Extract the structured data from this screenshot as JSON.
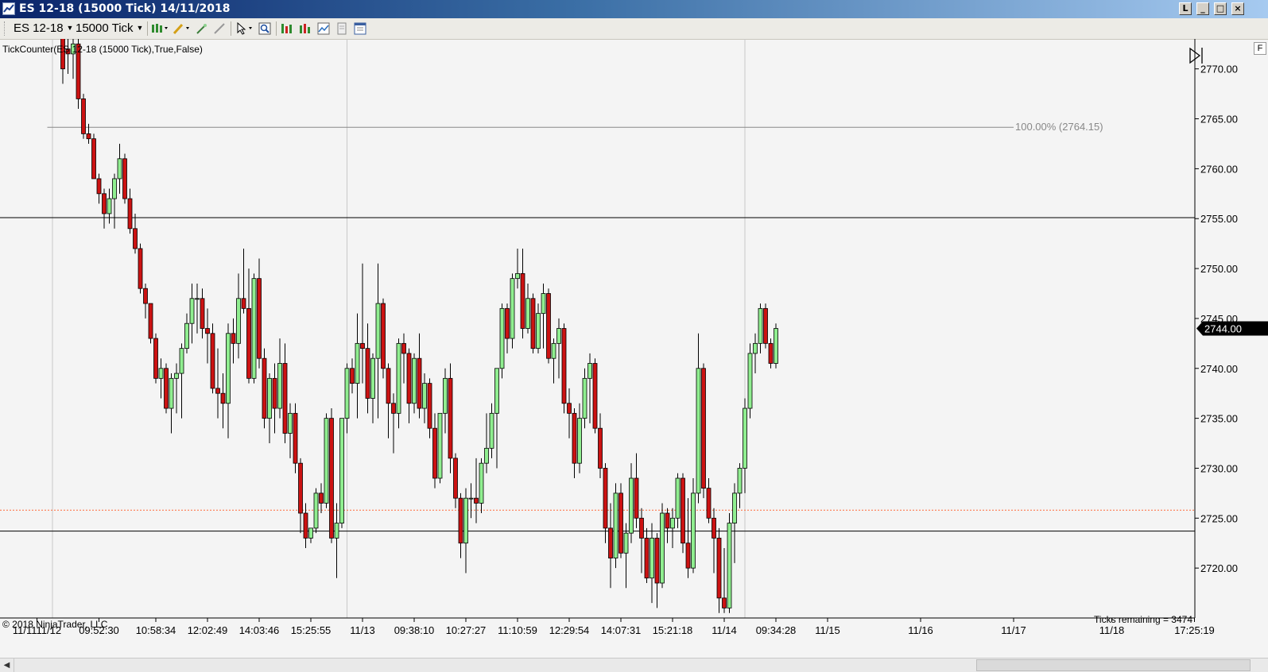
{
  "window": {
    "title": "ES 12-18 (15000 Tick)  14/11/2018",
    "buttons": [
      "L",
      "_",
      "□",
      "×"
    ]
  },
  "toolbar": {
    "instrument": "ES 12-18",
    "interval": "15000 Tick",
    "icons": [
      "candlestick-style-icon",
      "pencil-draw-icon",
      "magic-wand-icon",
      "pointer-tool-icon",
      "crosshair-cursor-icon",
      "zoom-icon",
      "bar-spacing-icon",
      "data-box-icon",
      "indicators-icon",
      "strategies-icon",
      "properties-icon"
    ]
  },
  "indicator_label": "TickCounter(ES  12-18 (15000  Tick),True,False)",
  "copyright": "© 2018 NinjaTrader, LLC",
  "ticks_remaining": "Ticks remaining = 3474",
  "right_edge_label": "F",
  "colors": {
    "background": "#f4f4f4",
    "up_candle": "#90ee90",
    "down_candle": "#cc1212",
    "candle_outline": "#000000",
    "horizontal_lines": "#000000",
    "dotted_line": "#ff6a3a",
    "fib_line": "#888888",
    "axis_text": "#000000"
  },
  "chart_data": {
    "type": "candlestick",
    "instrument": "ES 12-18",
    "bar_type": "15000 Tick",
    "ylim": [
      2715,
      2773
    ],
    "y_ticks": [
      2720,
      2725,
      2730,
      2735,
      2740,
      2745,
      2750,
      2755,
      2760,
      2765,
      2770
    ],
    "y_tick_labels": [
      "2720.00",
      "2725.00",
      "2730.00",
      "2735.00",
      "2740.00",
      "2745.00",
      "2750.00",
      "2755.00",
      "2760.00",
      "2765.00",
      "2770.00"
    ],
    "x_tick_labels": [
      "11/1111/12",
      "09:52:30",
      "10:58:34",
      "12:02:49",
      "14:03:46",
      "15:25:55",
      "11/13",
      "09:38:10",
      "10:27:27",
      "11:10:59",
      "12:29:54",
      "14:07:31",
      "15:21:18",
      "11/14",
      "09:34:28",
      "11/15",
      "11/16",
      "11/17",
      "11/18",
      "17:25:19"
    ],
    "x_tick_bar_index": [
      -5,
      7,
      18,
      28,
      38,
      48,
      58,
      68,
      78,
      88,
      98,
      108,
      118,
      128,
      138,
      148,
      166,
      184,
      203,
      219
    ],
    "session_separators_bar_index": [
      -2,
      55,
      132
    ],
    "last_price": 2744.0,
    "last_price_label": "2744.00",
    "horizontal_lines": [
      2755.1,
      2723.7
    ],
    "dotted_line": 2725.8,
    "fib_line": {
      "value": 2764.15,
      "label": "100.00% (2764.15)",
      "from_bar": -3,
      "to_bar": 184
    },
    "candles": [
      {
        "o": 2773.5,
        "h": 2773.5,
        "l": 2768.5,
        "c": 2770.0
      },
      {
        "o": 2772.0,
        "h": 2773.5,
        "l": 2769.5,
        "c": 2771.5
      },
      {
        "o": 2771.5,
        "h": 2773.5,
        "l": 2769.0,
        "c": 2772.5
      },
      {
        "o": 2772.5,
        "h": 2773.5,
        "l": 2766.0,
        "c": 2767.0
      },
      {
        "o": 2767.0,
        "h": 2767.5,
        "l": 2763.0,
        "c": 2763.5
      },
      {
        "o": 2763.5,
        "h": 2764.5,
        "l": 2762.5,
        "c": 2763.0
      },
      {
        "o": 2763.0,
        "h": 2763.5,
        "l": 2759.0,
        "c": 2759.0
      },
      {
        "o": 2759.0,
        "h": 2759.5,
        "l": 2756.5,
        "c": 2757.5
      },
      {
        "o": 2757.5,
        "h": 2758.0,
        "l": 2754.0,
        "c": 2755.5
      },
      {
        "o": 2755.5,
        "h": 2758.0,
        "l": 2754.5,
        "c": 2757.0
      },
      {
        "o": 2757.0,
        "h": 2759.5,
        "l": 2754.0,
        "c": 2759.0
      },
      {
        "o": 2759.0,
        "h": 2762.5,
        "l": 2757.5,
        "c": 2761.0
      },
      {
        "o": 2761.0,
        "h": 2761.5,
        "l": 2756.5,
        "c": 2757.0
      },
      {
        "o": 2757.0,
        "h": 2758.0,
        "l": 2753.5,
        "c": 2754.0
      },
      {
        "o": 2754.0,
        "h": 2755.5,
        "l": 2751.5,
        "c": 2752.0
      },
      {
        "o": 2752.0,
        "h": 2752.5,
        "l": 2747.5,
        "c": 2748.0
      },
      {
        "o": 2748.0,
        "h": 2748.5,
        "l": 2745.0,
        "c": 2746.5
      },
      {
        "o": 2746.5,
        "h": 2746.5,
        "l": 2742.5,
        "c": 2743.0
      },
      {
        "o": 2743.0,
        "h": 2743.5,
        "l": 2738.5,
        "c": 2739.0
      },
      {
        "o": 2739.0,
        "h": 2741.0,
        "l": 2737.0,
        "c": 2740.0
      },
      {
        "o": 2740.0,
        "h": 2740.5,
        "l": 2735.5,
        "c": 2736.0
      },
      {
        "o": 2736.0,
        "h": 2739.5,
        "l": 2733.5,
        "c": 2739.0
      },
      {
        "o": 2739.0,
        "h": 2740.5,
        "l": 2735.5,
        "c": 2739.5
      },
      {
        "o": 2739.5,
        "h": 2742.5,
        "l": 2735.0,
        "c": 2742.0
      },
      {
        "o": 2742.0,
        "h": 2745.5,
        "l": 2741.5,
        "c": 2744.5
      },
      {
        "o": 2744.5,
        "h": 2748.5,
        "l": 2742.5,
        "c": 2747.0
      },
      {
        "o": 2747.0,
        "h": 2748.5,
        "l": 2743.5,
        "c": 2747.0
      },
      {
        "o": 2747.0,
        "h": 2748.0,
        "l": 2743.0,
        "c": 2744.0
      },
      {
        "o": 2744.0,
        "h": 2746.0,
        "l": 2740.5,
        "c": 2743.5
      },
      {
        "o": 2743.5,
        "h": 2744.5,
        "l": 2737.5,
        "c": 2738.0
      },
      {
        "o": 2738.0,
        "h": 2742.0,
        "l": 2735.0,
        "c": 2737.5
      },
      {
        "o": 2737.5,
        "h": 2739.5,
        "l": 2734.0,
        "c": 2736.5
      },
      {
        "o": 2736.5,
        "h": 2744.5,
        "l": 2733.0,
        "c": 2743.5
      },
      {
        "o": 2743.5,
        "h": 2745.0,
        "l": 2740.5,
        "c": 2742.5
      },
      {
        "o": 2742.5,
        "h": 2749.5,
        "l": 2741.0,
        "c": 2747.0
      },
      {
        "o": 2747.0,
        "h": 2752.0,
        "l": 2745.5,
        "c": 2746.0
      },
      {
        "o": 2746.0,
        "h": 2750.0,
        "l": 2738.5,
        "c": 2739.0
      },
      {
        "o": 2739.0,
        "h": 2749.5,
        "l": 2738.5,
        "c": 2749.0
      },
      {
        "o": 2749.0,
        "h": 2751.0,
        "l": 2740.0,
        "c": 2741.0
      },
      {
        "o": 2741.0,
        "h": 2742.0,
        "l": 2734.0,
        "c": 2735.0
      },
      {
        "o": 2735.0,
        "h": 2739.5,
        "l": 2732.5,
        "c": 2739.0
      },
      {
        "o": 2739.0,
        "h": 2740.5,
        "l": 2733.5,
        "c": 2736.0
      },
      {
        "o": 2736.0,
        "h": 2743.0,
        "l": 2735.0,
        "c": 2740.5
      },
      {
        "o": 2740.5,
        "h": 2742.5,
        "l": 2732.5,
        "c": 2733.5
      },
      {
        "o": 2733.5,
        "h": 2736.5,
        "l": 2731.0,
        "c": 2735.5
      },
      {
        "o": 2735.5,
        "h": 2736.5,
        "l": 2729.5,
        "c": 2730.5
      },
      {
        "o": 2730.5,
        "h": 2731.0,
        "l": 2723.5,
        "c": 2725.5
      },
      {
        "o": 2725.5,
        "h": 2726.5,
        "l": 2722.0,
        "c": 2723.0
      },
      {
        "o": 2723.0,
        "h": 2724.0,
        "l": 2722.5,
        "c": 2724.0
      },
      {
        "o": 2724.0,
        "h": 2728.0,
        "l": 2723.5,
        "c": 2727.5
      },
      {
        "o": 2727.5,
        "h": 2728.5,
        "l": 2725.5,
        "c": 2726.5
      },
      {
        "o": 2726.5,
        "h": 2735.5,
        "l": 2726.0,
        "c": 2735.0
      },
      {
        "o": 2735.0,
        "h": 2736.0,
        "l": 2722.5,
        "c": 2723.0
      },
      {
        "o": 2723.0,
        "h": 2726.5,
        "l": 2719.0,
        "c": 2724.5
      },
      {
        "o": 2724.5,
        "h": 2735.0,
        "l": 2724.0,
        "c": 2735.0
      },
      {
        "o": 2735.0,
        "h": 2740.5,
        "l": 2733.5,
        "c": 2740.0
      },
      {
        "o": 2740.0,
        "h": 2741.0,
        "l": 2737.5,
        "c": 2738.5
      },
      {
        "o": 2738.5,
        "h": 2745.5,
        "l": 2735.0,
        "c": 2742.5
      },
      {
        "o": 2742.5,
        "h": 2750.5,
        "l": 2738.5,
        "c": 2742.0
      },
      {
        "o": 2742.0,
        "h": 2744.5,
        "l": 2735.5,
        "c": 2737.0
      },
      {
        "o": 2737.0,
        "h": 2741.5,
        "l": 2734.5,
        "c": 2741.0
      },
      {
        "o": 2741.0,
        "h": 2750.5,
        "l": 2735.0,
        "c": 2746.5
      },
      {
        "o": 2746.5,
        "h": 2747.0,
        "l": 2739.0,
        "c": 2740.0
      },
      {
        "o": 2740.0,
        "h": 2740.5,
        "l": 2733.0,
        "c": 2736.5
      },
      {
        "o": 2736.5,
        "h": 2737.5,
        "l": 2731.5,
        "c": 2735.5
      },
      {
        "o": 2735.5,
        "h": 2743.0,
        "l": 2734.0,
        "c": 2742.5
      },
      {
        "o": 2742.5,
        "h": 2743.5,
        "l": 2738.5,
        "c": 2741.5
      },
      {
        "o": 2741.5,
        "h": 2742.0,
        "l": 2734.5,
        "c": 2736.5
      },
      {
        "o": 2736.5,
        "h": 2741.5,
        "l": 2735.5,
        "c": 2741.0
      },
      {
        "o": 2741.0,
        "h": 2743.5,
        "l": 2735.0,
        "c": 2736.0
      },
      {
        "o": 2736.0,
        "h": 2739.5,
        "l": 2734.5,
        "c": 2738.5
      },
      {
        "o": 2738.5,
        "h": 2739.0,
        "l": 2733.0,
        "c": 2734.0
      },
      {
        "o": 2734.0,
        "h": 2735.5,
        "l": 2728.0,
        "c": 2729.0
      },
      {
        "o": 2729.0,
        "h": 2735.5,
        "l": 2728.5,
        "c": 2735.5
      },
      {
        "o": 2735.5,
        "h": 2740.0,
        "l": 2733.5,
        "c": 2739.0
      },
      {
        "o": 2739.0,
        "h": 2740.5,
        "l": 2729.5,
        "c": 2731.0
      },
      {
        "o": 2731.0,
        "h": 2731.5,
        "l": 2726.0,
        "c": 2727.0
      },
      {
        "o": 2727.0,
        "h": 2727.5,
        "l": 2721.0,
        "c": 2722.5
      },
      {
        "o": 2722.5,
        "h": 2728.0,
        "l": 2719.5,
        "c": 2727.0
      },
      {
        "o": 2727.0,
        "h": 2728.5,
        "l": 2725.0,
        "c": 2727.0
      },
      {
        "o": 2727.0,
        "h": 2731.0,
        "l": 2724.5,
        "c": 2726.5
      },
      {
        "o": 2726.5,
        "h": 2731.0,
        "l": 2725.5,
        "c": 2730.5
      },
      {
        "o": 2730.5,
        "h": 2735.5,
        "l": 2729.5,
        "c": 2732.0
      },
      {
        "o": 2732.0,
        "h": 2736.5,
        "l": 2731.0,
        "c": 2735.5
      },
      {
        "o": 2735.5,
        "h": 2740.0,
        "l": 2730.0,
        "c": 2740.0
      },
      {
        "o": 2740.0,
        "h": 2746.5,
        "l": 2739.0,
        "c": 2746.0
      },
      {
        "o": 2746.0,
        "h": 2746.5,
        "l": 2741.5,
        "c": 2743.0
      },
      {
        "o": 2743.0,
        "h": 2749.5,
        "l": 2742.0,
        "c": 2749.0
      },
      {
        "o": 2749.0,
        "h": 2752.0,
        "l": 2748.0,
        "c": 2749.5
      },
      {
        "o": 2749.5,
        "h": 2752.0,
        "l": 2743.0,
        "c": 2744.0
      },
      {
        "o": 2744.0,
        "h": 2748.5,
        "l": 2743.5,
        "c": 2747.0
      },
      {
        "o": 2747.0,
        "h": 2747.5,
        "l": 2741.5,
        "c": 2742.0
      },
      {
        "o": 2742.0,
        "h": 2746.5,
        "l": 2741.5,
        "c": 2745.5
      },
      {
        "o": 2745.5,
        "h": 2748.5,
        "l": 2742.0,
        "c": 2747.5
      },
      {
        "o": 2747.5,
        "h": 2748.0,
        "l": 2740.5,
        "c": 2741.0
      },
      {
        "o": 2741.0,
        "h": 2743.0,
        "l": 2738.5,
        "c": 2742.5
      },
      {
        "o": 2742.5,
        "h": 2745.0,
        "l": 2739.0,
        "c": 2744.0
      },
      {
        "o": 2744.0,
        "h": 2744.5,
        "l": 2735.5,
        "c": 2736.5
      },
      {
        "o": 2736.5,
        "h": 2738.0,
        "l": 2733.0,
        "c": 2735.5
      },
      {
        "o": 2735.5,
        "h": 2736.0,
        "l": 2729.0,
        "c": 2730.5
      },
      {
        "o": 2730.5,
        "h": 2736.5,
        "l": 2729.5,
        "c": 2735.0
      },
      {
        "o": 2735.0,
        "h": 2740.0,
        "l": 2734.0,
        "c": 2739.0
      },
      {
        "o": 2739.0,
        "h": 2741.5,
        "l": 2734.5,
        "c": 2740.5
      },
      {
        "o": 2740.5,
        "h": 2741.0,
        "l": 2733.5,
        "c": 2734.0
      },
      {
        "o": 2734.0,
        "h": 2735.5,
        "l": 2729.0,
        "c": 2730.0
      },
      {
        "o": 2730.0,
        "h": 2730.5,
        "l": 2722.5,
        "c": 2724.0
      },
      {
        "o": 2724.0,
        "h": 2726.5,
        "l": 2718.0,
        "c": 2721.0
      },
      {
        "o": 2721.0,
        "h": 2728.5,
        "l": 2720.0,
        "c": 2727.5
      },
      {
        "o": 2727.5,
        "h": 2728.5,
        "l": 2721.0,
        "c": 2721.5
      },
      {
        "o": 2721.5,
        "h": 2724.5,
        "l": 2718.0,
        "c": 2723.5
      },
      {
        "o": 2723.5,
        "h": 2730.5,
        "l": 2722.5,
        "c": 2729.0
      },
      {
        "o": 2729.0,
        "h": 2731.5,
        "l": 2724.0,
        "c": 2725.0
      },
      {
        "o": 2725.0,
        "h": 2726.0,
        "l": 2719.5,
        "c": 2723.0
      },
      {
        "o": 2723.0,
        "h": 2724.0,
        "l": 2718.5,
        "c": 2719.0
      },
      {
        "o": 2719.0,
        "h": 2724.5,
        "l": 2716.5,
        "c": 2723.0
      },
      {
        "o": 2723.0,
        "h": 2723.5,
        "l": 2716.0,
        "c": 2718.5
      },
      {
        "o": 2718.5,
        "h": 2726.5,
        "l": 2718.0,
        "c": 2725.5
      },
      {
        "o": 2725.5,
        "h": 2726.0,
        "l": 2722.5,
        "c": 2724.0
      },
      {
        "o": 2724.0,
        "h": 2726.0,
        "l": 2722.0,
        "c": 2725.0
      },
      {
        "o": 2725.0,
        "h": 2729.5,
        "l": 2724.0,
        "c": 2729.0
      },
      {
        "o": 2729.0,
        "h": 2729.5,
        "l": 2721.5,
        "c": 2722.5
      },
      {
        "o": 2722.5,
        "h": 2727.0,
        "l": 2719.0,
        "c": 2720.0
      },
      {
        "o": 2720.0,
        "h": 2729.0,
        "l": 2719.5,
        "c": 2727.5
      },
      {
        "o": 2727.5,
        "h": 2743.5,
        "l": 2726.5,
        "c": 2740.0
      },
      {
        "o": 2740.0,
        "h": 2740.5,
        "l": 2727.0,
        "c": 2728.0
      },
      {
        "o": 2728.0,
        "h": 2729.0,
        "l": 2724.5,
        "c": 2725.0
      },
      {
        "o": 2725.0,
        "h": 2726.0,
        "l": 2719.5,
        "c": 2723.0
      },
      {
        "o": 2723.0,
        "h": 2724.0,
        "l": 2715.5,
        "c": 2717.0
      },
      {
        "o": 2717.0,
        "h": 2722.0,
        "l": 2715.5,
        "c": 2716.0
      },
      {
        "o": 2716.0,
        "h": 2725.5,
        "l": 2715.5,
        "c": 2724.5
      },
      {
        "o": 2724.5,
        "h": 2728.5,
        "l": 2720.5,
        "c": 2727.5
      },
      {
        "o": 2727.5,
        "h": 2730.5,
        "l": 2726.0,
        "c": 2730.0
      },
      {
        "o": 2730.0,
        "h": 2737.0,
        "l": 2727.5,
        "c": 2736.0
      },
      {
        "o": 2736.0,
        "h": 2742.5,
        "l": 2735.0,
        "c": 2741.5
      },
      {
        "o": 2741.5,
        "h": 2743.5,
        "l": 2739.5,
        "c": 2742.5
      },
      {
        "o": 2742.5,
        "h": 2746.5,
        "l": 2741.5,
        "c": 2746.0
      },
      {
        "o": 2746.0,
        "h": 2746.5,
        "l": 2742.0,
        "c": 2742.5
      },
      {
        "o": 2742.5,
        "h": 2743.0,
        "l": 2740.0,
        "c": 2740.5
      },
      {
        "o": 2740.5,
        "h": 2744.5,
        "l": 2740.0,
        "c": 2744.0
      }
    ]
  }
}
